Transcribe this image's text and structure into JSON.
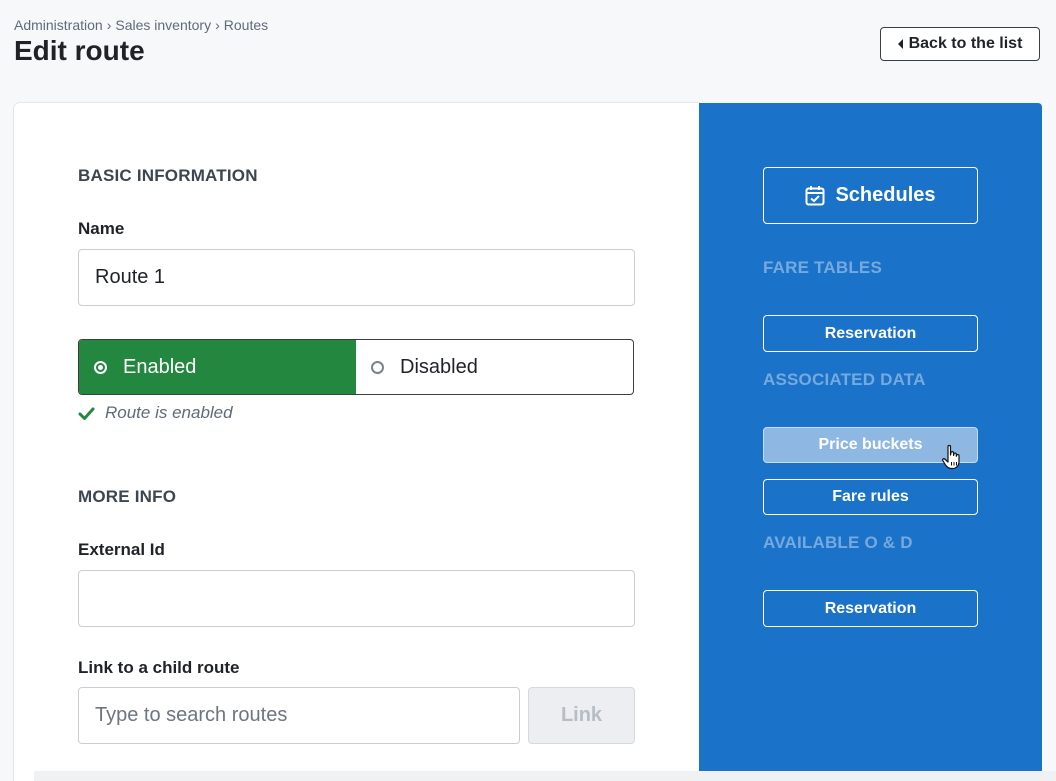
{
  "breadcrumb": {
    "items": [
      "Administration",
      "Sales inventory",
      "Routes"
    ],
    "separator": "›"
  },
  "page": {
    "title": "Edit route",
    "back_label": "Back to the list"
  },
  "basic_info": {
    "section_title": "BASIC INFORMATION",
    "name_label": "Name",
    "name_value": "Route 1",
    "status_options": {
      "enabled": "Enabled",
      "disabled": "Disabled",
      "selected": "enabled"
    },
    "status_message": "Route is enabled"
  },
  "more_info": {
    "section_title": "MORE INFO",
    "external_id_label": "External Id",
    "external_id_value": "",
    "child_route_label": "Link to a child route",
    "child_route_placeholder": "Type to search routes",
    "link_button_label": "Link"
  },
  "side_panel": {
    "schedules_label": "Schedules",
    "fare_tables": {
      "title": "FARE TABLES",
      "buttons": [
        "Reservation"
      ]
    },
    "associated_data": {
      "title": "ASSOCIATED DATA",
      "buttons": [
        "Price buckets",
        "Fare rules"
      ],
      "hovered": "Price buckets"
    },
    "available_od": {
      "title": "AVAILABLE O & D",
      "buttons": [
        "Reservation"
      ]
    }
  },
  "colors": {
    "accent_blue": "#1a73c8",
    "enabled_green": "#23873f",
    "hover_button": "#8eb7e2"
  },
  "icons": [
    "caret-left-icon",
    "calendar-check-icon",
    "radio-selected-icon",
    "radio-empty-icon",
    "check-icon",
    "hand-pointer-icon"
  ]
}
